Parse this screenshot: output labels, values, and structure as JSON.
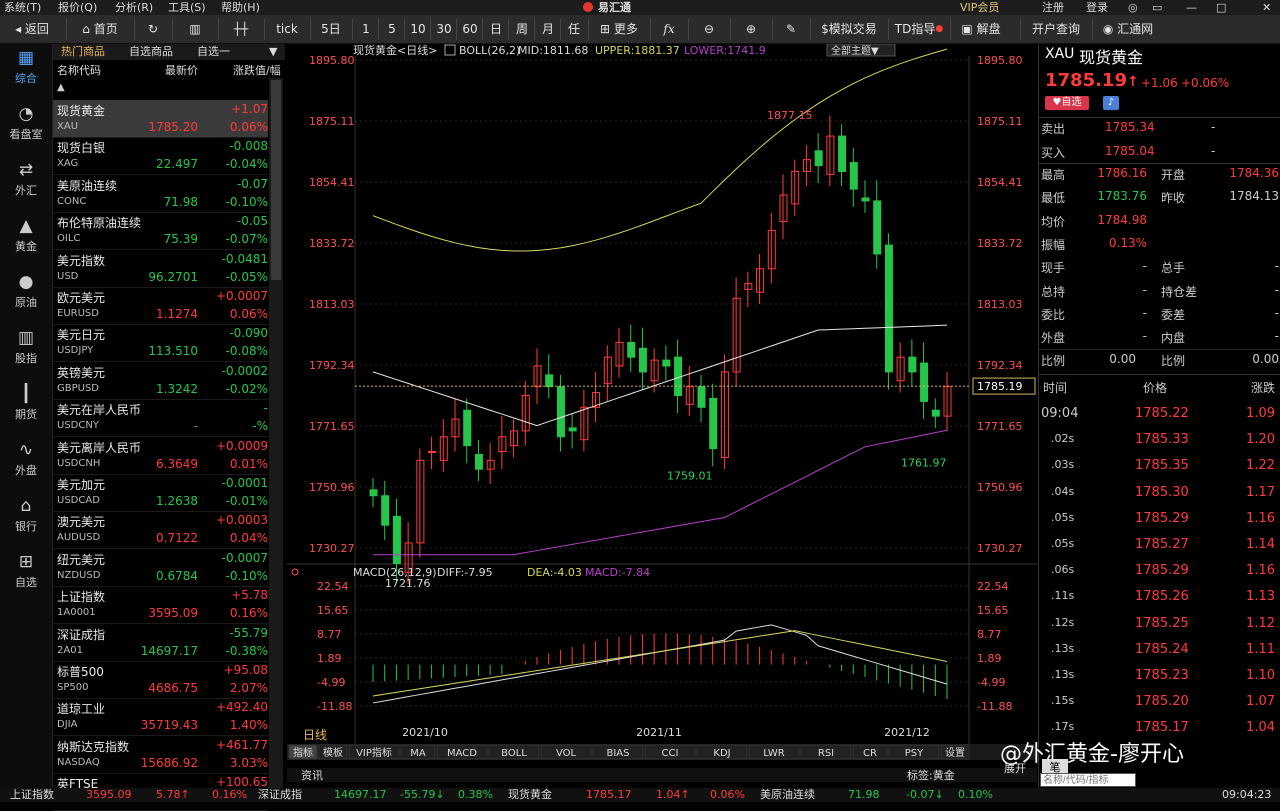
{
  "menu": [
    "系统(T)",
    "报价(Q)",
    "分析(R)",
    "工具(S)",
    "帮助(H)"
  ],
  "app_title": "易汇通",
  "top_right": [
    "VIP会员",
    "注册",
    "登录"
  ],
  "toolbar": {
    "back": "返回",
    "home": "首页",
    "tick": "tick",
    "d5": "5日",
    "periods": [
      "1",
      "5",
      "10",
      "30",
      "60",
      "日",
      "周",
      "月",
      "任"
    ],
    "more": "更多",
    "sim": "$模拟交易",
    "td": "TD指导",
    "interpret": "解盘",
    "open_query": "开户查询",
    "huihui": "汇通网"
  },
  "nav": [
    {
      "label": "综合",
      "icon": "grid-icon"
    },
    {
      "label": "看盘室",
      "icon": "chat-icon"
    },
    {
      "label": "外汇",
      "icon": "exchange-icon"
    },
    {
      "label": "黄金",
      "icon": "gold-bars-icon"
    },
    {
      "label": "原油",
      "icon": "oil-drop-icon"
    },
    {
      "label": "股指",
      "icon": "bar-chart-icon"
    },
    {
      "label": "期货",
      "icon": "candle-icon"
    },
    {
      "label": "外盘",
      "icon": "trend-icon"
    },
    {
      "label": "银行",
      "icon": "bank-icon"
    },
    {
      "label": "自选",
      "icon": "plus-box-icon"
    }
  ],
  "qlist": {
    "tabs": [
      "热门商品",
      "自选商品",
      "自选一"
    ],
    "headers": {
      "name": "名称代码",
      "price": "最新价",
      "change": "涨跌值/幅"
    },
    "rows": [
      {
        "name": "现货黄金",
        "code": "XAU",
        "price": "1785.20",
        "chg": "+1.07",
        "pct": "0.06%",
        "dir": "up"
      },
      {
        "name": "现货白银",
        "code": "XAG",
        "price": "22.497",
        "chg": "-0.008",
        "pct": "-0.04%",
        "dir": "dn"
      },
      {
        "name": "美原油连续",
        "code": "CONC",
        "price": "71.98",
        "chg": "-0.07",
        "pct": "-0.10%",
        "dir": "dn"
      },
      {
        "name": "布伦特原油连续",
        "code": "OILC",
        "price": "75.39",
        "chg": "-0.05",
        "pct": "-0.07%",
        "dir": "dn"
      },
      {
        "name": "美元指数",
        "code": "USD",
        "price": "96.2701",
        "chg": "-0.0481",
        "pct": "-0.05%",
        "dir": "dn"
      },
      {
        "name": "欧元美元",
        "code": "EURUSD",
        "price": "1.1274",
        "chg": "+0.0007",
        "pct": "0.06%",
        "dir": "up"
      },
      {
        "name": "美元日元",
        "code": "USDJPY",
        "price": "113.510",
        "chg": "-0.090",
        "pct": "-0.08%",
        "dir": "dn"
      },
      {
        "name": "英镑美元",
        "code": "GBPUSD",
        "price": "1.3242",
        "chg": "-0.0002",
        "pct": "-0.02%",
        "dir": "dn"
      },
      {
        "name": "美元在岸人民币",
        "code": "USDCNY",
        "price": "-",
        "chg": "-",
        "pct": "-%",
        "dir": "dn"
      },
      {
        "name": "美元离岸人民币",
        "code": "USDCNH",
        "price": "6.3649",
        "chg": "+0.0009",
        "pct": "0.01%",
        "dir": "up"
      },
      {
        "name": "美元加元",
        "code": "USDCAD",
        "price": "1.2638",
        "chg": "-0.0001",
        "pct": "-0.01%",
        "dir": "dn"
      },
      {
        "name": "澳元美元",
        "code": "AUDUSD",
        "price": "0.7122",
        "chg": "+0.0003",
        "pct": "0.04%",
        "dir": "up"
      },
      {
        "name": "纽元美元",
        "code": "NZDUSD",
        "price": "0.6784",
        "chg": "-0.0007",
        "pct": "-0.10%",
        "dir": "dn"
      },
      {
        "name": "上证指数",
        "code": "1A0001",
        "price": "3595.09",
        "chg": "+5.78",
        "pct": "0.16%",
        "dir": "up"
      },
      {
        "name": "深证成指",
        "code": "2A01",
        "price": "14697.17",
        "chg": "-55.79",
        "pct": "-0.38%",
        "dir": "dn"
      },
      {
        "name": "标普500",
        "code": "SP500",
        "price": "4686.75",
        "chg": "+95.08",
        "pct": "2.07%",
        "dir": "up"
      },
      {
        "name": "道琼工业",
        "code": "DJIA",
        "price": "35719.43",
        "chg": "+492.40",
        "pct": "1.40%",
        "dir": "up"
      },
      {
        "name": "纳斯达克指数",
        "code": "NASDAQ",
        "price": "15686.92",
        "chg": "+461.77",
        "pct": "3.03%",
        "dir": "up"
      },
      {
        "name": "英FTSE",
        "code": "",
        "price": "",
        "chg": "+100.65",
        "pct": "",
        "dir": "up"
      }
    ]
  },
  "chart": {
    "title": "现货黄金<日线>",
    "boll": "BOLL(26,2)",
    "mid": "MID:1811.68",
    "upper": "UPPER:1881.37",
    "lower": "LOWER:1741.9",
    "theme_btn": "全部主题▼",
    "price_labels": [
      "1895.80",
      "1875.11",
      "1854.41",
      "1833.72",
      "1813.03",
      "1792.34",
      "1771.65",
      "1750.96",
      "1730.27"
    ],
    "current": "1785.19",
    "annot": {
      "high": "1877.15",
      "low1": "1721.76",
      "low2": "1759.01",
      "low3": "1761.97"
    },
    "macd_title": "MACD(26,12,9)",
    "diff": "DIFF:-7.95",
    "dea": "DEA:-4.03",
    "macd": "MACD:-7.84",
    "macd_labels": [
      "22.54",
      "15.65",
      "8.77",
      "1.89",
      "-4.99",
      "-11.88"
    ],
    "dates": [
      "2021/10",
      "2021/11",
      "2021/12"
    ],
    "period_label": "日线",
    "tabs": [
      "指标",
      "模板",
      "VIP指标",
      "MA",
      "MACD",
      "BOLL",
      "VOL",
      "BIAS",
      "CCI",
      "KDJ",
      "LWR",
      "RSI",
      "CR",
      "PSY",
      "设置"
    ],
    "bottom": {
      "news": "资讯",
      "label": "标签:黄金",
      "expand": "展开",
      "pen": "笔"
    }
  },
  "colors": {
    "up": "#ff3b3b",
    "down": "#26c64a",
    "upper": "#d8d65a",
    "mid": "#e8e8e8",
    "lower": "#b93fcb",
    "grid": "#262626"
  },
  "right": {
    "code": "XAU",
    "name": "现货黄金",
    "price": "1785.19",
    "chg": "+1.06",
    "pct": "+0.06%",
    "btn_fav": "自选",
    "sell": {
      "label": "卖出",
      "value": "1785.34",
      "vol": "-"
    },
    "buy": {
      "label": "买入",
      "value": "1785.04",
      "vol": "-"
    },
    "stats": [
      {
        "l1": "最高",
        "v1": "1786.16",
        "l2": "开盘",
        "v2": "1784.36"
      },
      {
        "l1": "最低",
        "v1": "1783.76",
        "l2": "昨收",
        "v2": "1784.13"
      },
      {
        "l1": "均价",
        "v1": "1784.98",
        "l2": "",
        "v2": ""
      },
      {
        "l1": "振幅",
        "v1": "0.13%",
        "l2": "",
        "v2": ""
      },
      {
        "l1": "现手",
        "v1": "-",
        "l2": "总手",
        "v2": "-"
      },
      {
        "l1": "总持",
        "v1": "-",
        "l2": "持仓差",
        "v2": "-"
      },
      {
        "l1": "委比",
        "v1": "-",
        "l2": "委差",
        "v2": "-"
      },
      {
        "l1": "外盘",
        "v1": "-",
        "l2": "内盘",
        "v2": "-"
      },
      {
        "l1": "比例",
        "v1": "0.00",
        "l2": "比例",
        "v2": "0.00"
      }
    ],
    "tick_headers": [
      "时间",
      "价格",
      "涨跌"
    ],
    "ticks": [
      {
        "t": "09:04",
        "p": "1785.22",
        "c": "1.09"
      },
      {
        "t": ".02s",
        "p": "1785.33",
        "c": "1.20"
      },
      {
        "t": ".03s",
        "p": "1785.35",
        "c": "1.22"
      },
      {
        "t": ".04s",
        "p": "1785.30",
        "c": "1.17"
      },
      {
        "t": ".05s",
        "p": "1785.29",
        "c": "1.16"
      },
      {
        "t": ".05s",
        "p": "1785.27",
        "c": "1.14"
      },
      {
        "t": ".06s",
        "p": "1785.29",
        "c": "1.16"
      },
      {
        "t": ".11s",
        "p": "1785.26",
        "c": "1.13"
      },
      {
        "t": ".12s",
        "p": "1785.25",
        "c": "1.12"
      },
      {
        "t": ".13s",
        "p": "1785.24",
        "c": "1.11"
      },
      {
        "t": ".13s",
        "p": "1785.23",
        "c": "1.10"
      },
      {
        "t": ".15s",
        "p": "1785.20",
        "c": "1.07"
      },
      {
        "t": ".17s",
        "p": "1785.17",
        "c": "1.04"
      }
    ],
    "search_placeholder": "名称/代码/指标"
  },
  "watermark": "@外汇黄金-廖开心",
  "status": [
    {
      "t": "上证指数",
      "c": "wh"
    },
    {
      "t": "3595.09",
      "c": "up"
    },
    {
      "t": "5.78↑",
      "c": "up"
    },
    {
      "t": "0.16%",
      "c": "up"
    },
    {
      "t": "深证成指",
      "c": "wh"
    },
    {
      "t": "14697.17",
      "c": "dn"
    },
    {
      "t": "-55.79↓",
      "c": "dn"
    },
    {
      "t": "0.38%",
      "c": "dn"
    },
    {
      "t": "现货黄金",
      "c": "wh"
    },
    {
      "t": "1785.17",
      "c": "up"
    },
    {
      "t": "1.04↑",
      "c": "up"
    },
    {
      "t": "0.06%",
      "c": "up"
    },
    {
      "t": "美原油连续",
      "c": "wh"
    },
    {
      "t": "71.98",
      "c": "dn"
    },
    {
      "t": "-0.07↓",
      "c": "dn"
    },
    {
      "t": "0.10%",
      "c": "dn"
    },
    {
      "t": "09:04:23",
      "c": "wh"
    }
  ]
}
